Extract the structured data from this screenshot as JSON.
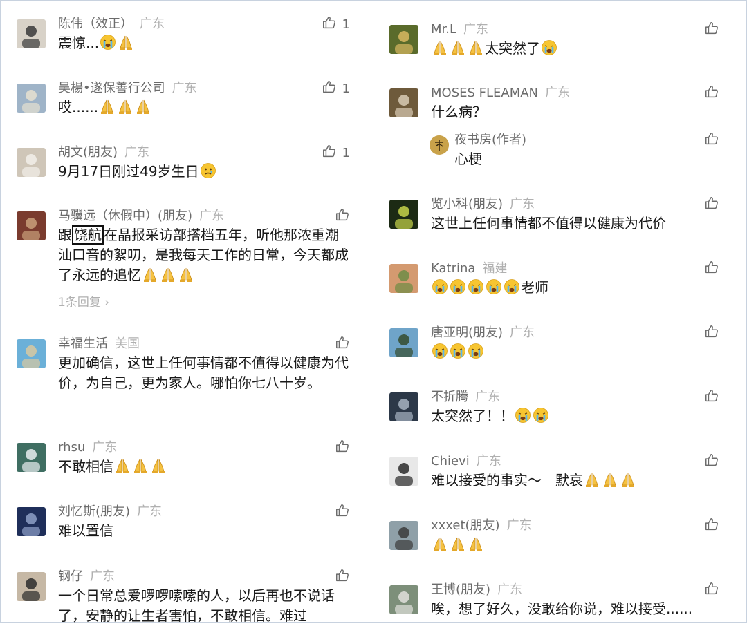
{
  "left_comments": [
    {
      "name": "陈伟（效正）",
      "location": "广东",
      "likes": "1",
      "text": "震惊...",
      "emoji": [
        "cry",
        "pray"
      ]
    },
    {
      "name": "吴楊•遂保善行公司",
      "location": "广东",
      "likes": "1",
      "text": "哎......",
      "emoji": [
        "pray",
        "pray",
        "pray"
      ]
    },
    {
      "name": "胡文(朋友)",
      "location": "广东",
      "likes": "1",
      "text": "9月17日刚过49岁生日",
      "emoji": [
        "sad"
      ]
    },
    {
      "name": "马骥远（休假中）(朋友)",
      "location": "广东",
      "likes": "",
      "text_before": "跟",
      "text_highlight": "饶航",
      "text_after": "在晶报采访部搭档五年，听他那浓重潮汕口音的絮叨，是我每天工作的日常，今天都成了永远的追忆",
      "emoji": [
        "pray",
        "pray",
        "pray"
      ],
      "more": "1条回复"
    },
    {
      "name": "幸福生活",
      "location": "美国",
      "likes": "",
      "text": "更加确信，这世上任何事情都不值得以健康为代价，为自己，更为家人。哪怕你七八十岁。",
      "emoji": []
    },
    {
      "name": "rhsu",
      "location": "广东",
      "likes": "",
      "text": "不敢相信",
      "emoji": [
        "pray",
        "pray",
        "pray"
      ]
    },
    {
      "name": "刘忆斯(朋友)",
      "location": "广东",
      "likes": "",
      "text": "难以置信",
      "emoji": []
    },
    {
      "name": "钢仔",
      "location": "广东",
      "likes": "",
      "text": "一个日常总爱啰啰嗦嗦的人，以后再也不说话了，安静的让生者害怕，不敢相信。难过",
      "emoji": []
    }
  ],
  "right_comments": [
    {
      "name": "Mr.L",
      "location": "广东",
      "likes": "",
      "text_before_emoji": true,
      "text": "太突然了",
      "emoji_pre": [
        "pray",
        "pray",
        "pray"
      ],
      "emoji": [
        "cry"
      ]
    },
    {
      "name": "MOSES FLEAMAN",
      "location": "广东",
      "likes": "",
      "text": "什么病？",
      "emoji": [],
      "reply": {
        "name": "夜书房(作者)",
        "text": "心梗"
      }
    },
    {
      "name": "览小科(朋友)",
      "location": "广东",
      "likes": "",
      "text": "这世上任何事情都不值得以健康为代价",
      "emoji": []
    },
    {
      "name": "Katrina",
      "location": "福建",
      "likes": "",
      "text": "老师",
      "emoji_pre": [
        "cry",
        "cry",
        "cry",
        "cry",
        "cry"
      ],
      "emoji": []
    },
    {
      "name": "唐亚明(朋友)",
      "location": "广东",
      "likes": "",
      "text": "",
      "emoji": [
        "cry",
        "cry",
        "cry"
      ]
    },
    {
      "name": "不折腾",
      "location": "广东",
      "likes": "",
      "text": "太突然了！！",
      "emoji": [
        "cry",
        "cry"
      ]
    },
    {
      "name": "Chievi",
      "location": "广东",
      "likes": "",
      "text": "难以接受的事实～　默哀",
      "emoji": [
        "pray",
        "pray",
        "pray"
      ]
    },
    {
      "name": "xxxet(朋友)",
      "location": "广东",
      "likes": "",
      "text": "",
      "emoji": [
        "pray",
        "pray",
        "pray"
      ]
    },
    {
      "name": "王博(朋友)",
      "location": "广东",
      "likes": "",
      "text": "唉，想了好久，没敢给你说，难以接受......",
      "emoji": []
    }
  ],
  "colors": {
    "name": "#6b6b6b",
    "location": "#b0b0b0",
    "text": "#191919",
    "border": "#c8d2df"
  },
  "icons": {
    "like": "thumbs-up-icon",
    "chevron": "chevron-right-icon"
  }
}
